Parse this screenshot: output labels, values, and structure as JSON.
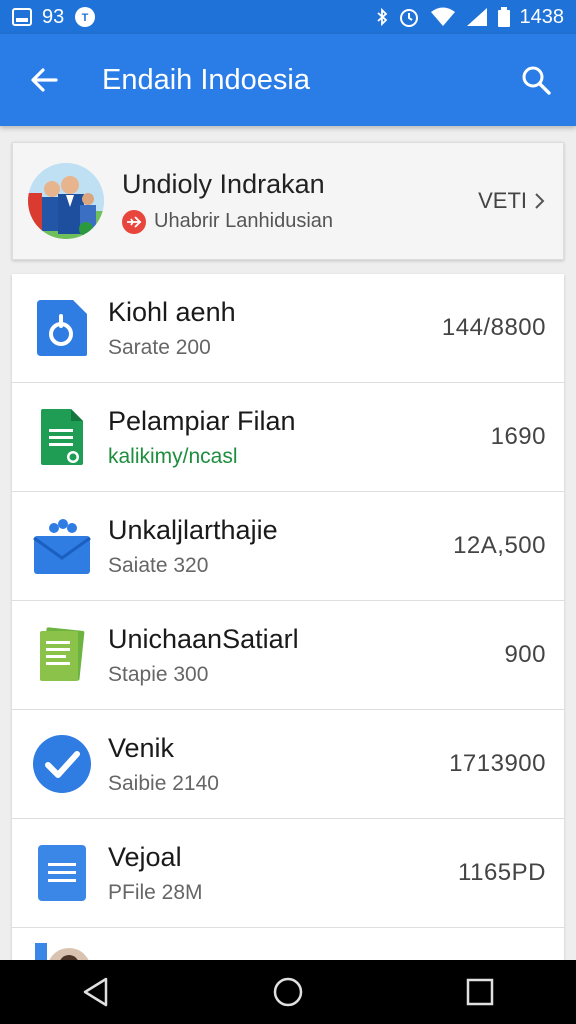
{
  "status_bar": {
    "left_text": "93",
    "time": "1438"
  },
  "app_bar": {
    "title": "Endaih Indoesia"
  },
  "header_card": {
    "title": "Undioly Indrakan",
    "subtitle": "Uhabrir Lanhidusian",
    "action_label": "VETI"
  },
  "list": {
    "items": [
      {
        "title": "Kiohl aenh",
        "subtitle": "Sarate 200",
        "value": "144/8800",
        "icon": "google-drive-blue-icon"
      },
      {
        "title": "Pelampiar Filan",
        "subtitle": "kalikimy/ncasl",
        "value": "1690",
        "icon": "google-sheets-icon"
      },
      {
        "title": "Unkaljlarthajie",
        "subtitle": "Saiate 320",
        "value": "12A,500",
        "icon": "mail-envelope-icon"
      },
      {
        "title": "UnichaanSatiarl",
        "subtitle": "Stapie 300",
        "value": "900",
        "icon": "green-document-icon"
      },
      {
        "title": "Venik",
        "subtitle": "Saibie 2140",
        "value": "1713900",
        "icon": "check-circle-icon"
      },
      {
        "title": "Vejoal",
        "subtitle": "PFile 28M",
        "value": "1165PD",
        "icon": "google-docs-icon"
      }
    ]
  },
  "colors": {
    "status_bar": "#1f73d8",
    "app_bar": "#2a7de6",
    "accent_green": "#1e8e3e"
  }
}
